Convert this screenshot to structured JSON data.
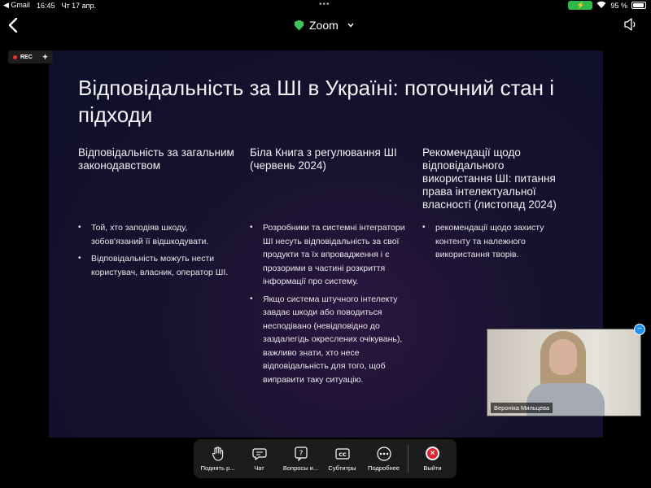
{
  "status_bar": {
    "back_app": "◀ Gmail",
    "time": "16:45",
    "date": "Чт 17 апр.",
    "battery_percent": "95 %",
    "battery_level": 0.95
  },
  "top_bar": {
    "app_title": "Zoom"
  },
  "recording": {
    "label": "REC"
  },
  "slide": {
    "title": "Відповідальність за ШІ в Україні: поточний стан і підходи",
    "columns": [
      {
        "heading": "Відповідальність за загальним законодавством",
        "bullets": [
          "Той, хто заподіяв шкоду, зобов'язаний її відшкодувати.",
          "Відповідальність можуть нести користувач, власник, оператор ШІ."
        ]
      },
      {
        "heading": "Біла Книга з регулювання ШІ (червень 2024)",
        "bullets": [
          "Розробники та системні інтегратори ШІ несуть відповідальність за свої продукти та їх впровадження і є прозорими в частині розкриття інформації про систему.",
          "Якщо система штучного інтелекту завдає шкоди або поводиться несподівано (невідповідно до заздалегідь окреслених очікувань), важливо знати, хто несе відповідальність для того, щоб виправити таку ситуацію."
        ]
      },
      {
        "heading": "Рекомендації щодо відповідального використання ШІ: питання права інтелектуальної власності (листопад 2024)",
        "bullets": [
          "рекомендації щодо захисту контенту та належного використання творів."
        ]
      }
    ]
  },
  "video": {
    "participant_name": "Вероніка Мильцева"
  },
  "toolbar": {
    "raise_hand": "Поднять р...",
    "chat": "Чат",
    "qa": "Вопросы и...",
    "captions": "Субтитры",
    "more": "Подробнее",
    "exit": "Выйти"
  }
}
